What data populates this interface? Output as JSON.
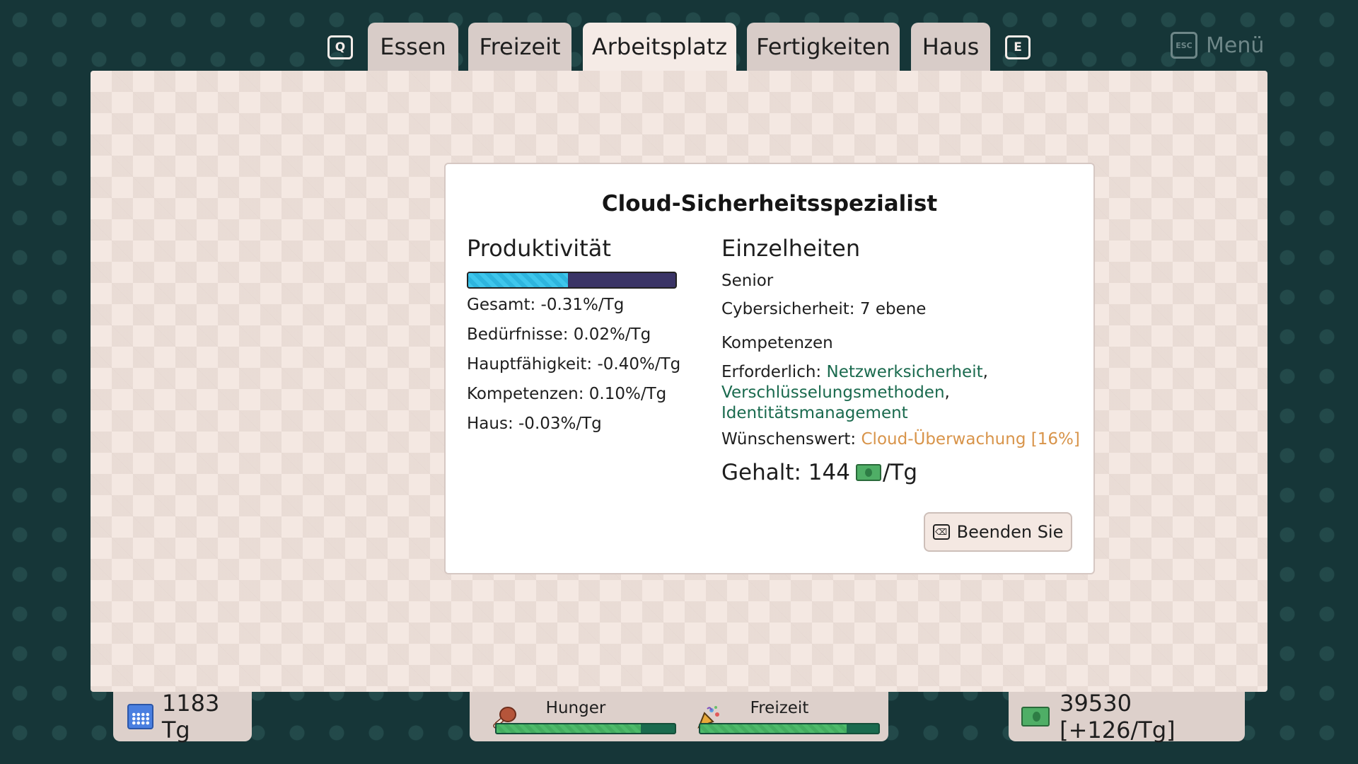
{
  "tabs": {
    "prev_key": "Q",
    "next_key": "E",
    "items": [
      {
        "label": "Essen"
      },
      {
        "label": "Freizeit"
      },
      {
        "label": "Arbeitsplatz"
      },
      {
        "label": "Fertigkeiten"
      },
      {
        "label": "Haus"
      }
    ],
    "active_index": 2
  },
  "menu": {
    "key": "ESC",
    "label": "Menü"
  },
  "job": {
    "title": "Cloud-Sicherheitsspezialist",
    "productivity": {
      "heading": "Produktivität",
      "fill_fraction": 0.48,
      "lines": [
        "Gesamt: -0.31%/Tg",
        "Bedürfnisse: 0.02%/Tg",
        "Hauptfähigkeit: -0.40%/Tg",
        "Kompetenzen: 0.10%/Tg",
        "Haus: -0.03%/Tg"
      ]
    },
    "details": {
      "heading": "Einzelheiten",
      "level": "Senior",
      "skill": "Cybersicherheit: 7 ebene",
      "competencies_heading": "Kompetenzen",
      "required_label": "Erforderlich: ",
      "required": [
        "Netzwerksicherheit",
        "Verschlüsselungsmethoden",
        "Identitätsmanagement"
      ],
      "desired_label": "Wünschenswert: ",
      "desired": "Cloud-Überwachung [16%]",
      "salary_label": "Gehalt: 144",
      "salary_unit": "/Tg"
    },
    "quit_label": "Beenden Sie"
  },
  "status": {
    "days": "1183 Tg",
    "needs": [
      {
        "label": "Hunger",
        "icon": "drumstick-icon",
        "fill_fraction": 0.81
      },
      {
        "label": "Freizeit",
        "icon": "party-popper-icon",
        "fill_fraction": 0.82
      }
    ],
    "money": "39530 [+126/Tg]"
  },
  "colors": {
    "background": "#163638",
    "panel": "#f4e8e2",
    "required_comp": "#1a6a4e",
    "desired_comp": "#d8944a",
    "productivity_fill": "#3ec6ec",
    "needs_fill": "#4dba6a"
  }
}
